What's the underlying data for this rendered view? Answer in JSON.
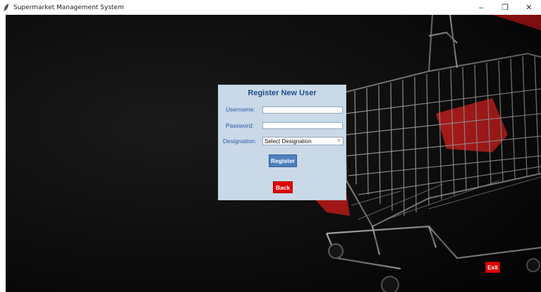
{
  "window": {
    "title": "Supermarket Management System",
    "minimize_label": "–",
    "maximize_label": "❐",
    "close_label": "✕"
  },
  "register_form": {
    "title": "Register New User",
    "username_label": "Username:",
    "username_value": "",
    "password_label": "Password:",
    "password_value": "",
    "designation_label": "Designation:",
    "designation_selected": "Select Designation",
    "register_button": "Register",
    "back_button": "Back"
  },
  "exit_button": "Exit",
  "colors": {
    "panel_bg": "#cad9e8",
    "title_color": "#1f4e8c",
    "register_button": "#4f80bd",
    "danger_button": "#e00000",
    "background": "#0e0e0e"
  },
  "icons": {
    "app": "feather-icon",
    "dropdown": "chevron-down-icon"
  }
}
